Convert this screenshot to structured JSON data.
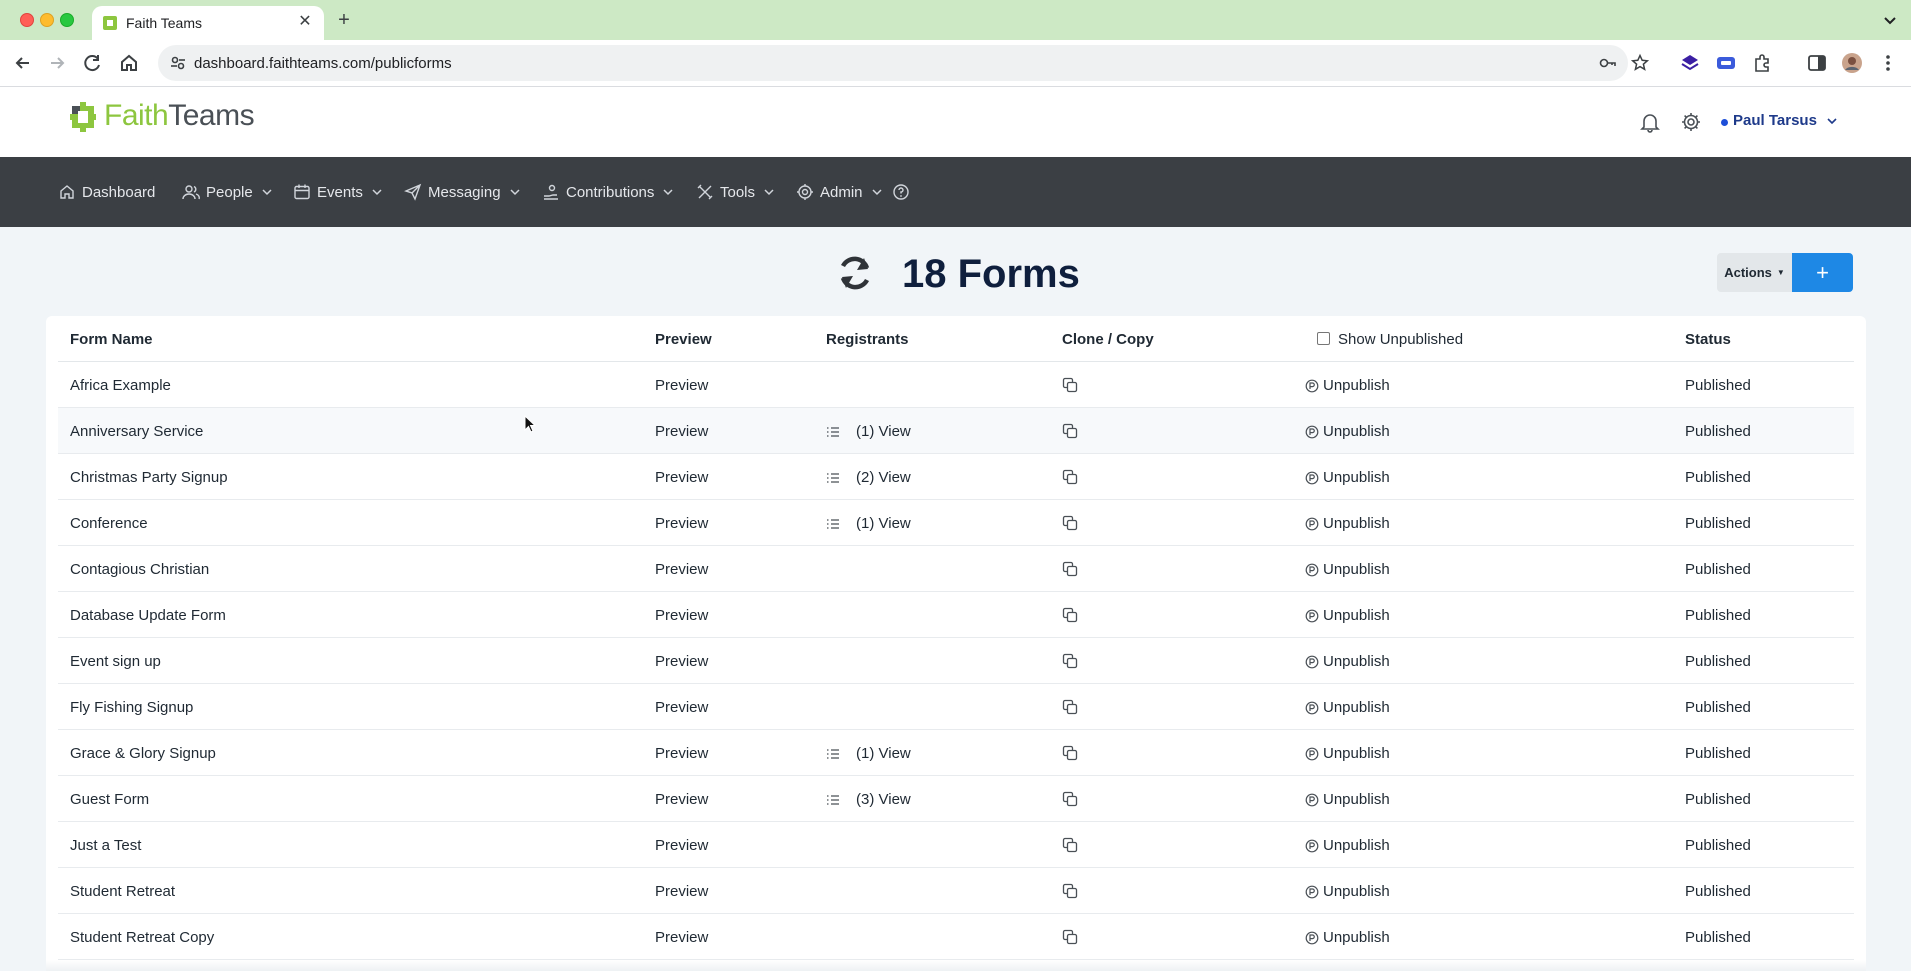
{
  "browser": {
    "tab_title": "Faith Teams",
    "url": "dashboard.faithteams.com/publicforms"
  },
  "brand": {
    "logo_part1": "Faith",
    "logo_part2": "Teams",
    "accent": "#8dc63f",
    "primary_button": "#1e88e5",
    "nav_bg": "#3b3f44"
  },
  "header": {
    "user_name": "Paul Tarsus"
  },
  "nav": {
    "items": [
      {
        "label": "Dashboard",
        "icon": "home-icon"
      },
      {
        "label": "People",
        "icon": "people-icon"
      },
      {
        "label": "Events",
        "icon": "calendar-icon"
      },
      {
        "label": "Messaging",
        "icon": "send-icon"
      },
      {
        "label": "Contributions",
        "icon": "hand-coin-icon"
      },
      {
        "label": "Tools",
        "icon": "tools-icon"
      },
      {
        "label": "Admin",
        "icon": "gear-icon"
      }
    ]
  },
  "page": {
    "title": "18 Forms",
    "actions_label": "Actions",
    "add_label": "+"
  },
  "table": {
    "headers": {
      "name": "Form Name",
      "preview": "Preview",
      "registrants": "Registrants",
      "clone": "Clone / Copy",
      "show_unpublished": "Show Unpublished",
      "status": "Status"
    },
    "rows": [
      {
        "name": "Africa Example",
        "preview": "Preview",
        "registrants": "",
        "unpublish": "Unpublish",
        "status": "Published"
      },
      {
        "name": "Anniversary Service",
        "preview": "Preview",
        "registrants": "(1) View",
        "unpublish": "Unpublish",
        "status": "Published"
      },
      {
        "name": "Christmas Party Signup",
        "preview": "Preview",
        "registrants": "(2) View",
        "unpublish": "Unpublish",
        "status": "Published"
      },
      {
        "name": "Conference",
        "preview": "Preview",
        "registrants": "(1) View",
        "unpublish": "Unpublish",
        "status": "Published"
      },
      {
        "name": "Contagious Christian",
        "preview": "Preview",
        "registrants": "",
        "unpublish": "Unpublish",
        "status": "Published"
      },
      {
        "name": "Database Update Form",
        "preview": "Preview",
        "registrants": "",
        "unpublish": "Unpublish",
        "status": "Published"
      },
      {
        "name": "Event sign up",
        "preview": "Preview",
        "registrants": "",
        "unpublish": "Unpublish",
        "status": "Published"
      },
      {
        "name": "Fly Fishing Signup",
        "preview": "Preview",
        "registrants": "",
        "unpublish": "Unpublish",
        "status": "Published"
      },
      {
        "name": "Grace & Glory Signup",
        "preview": "Preview",
        "registrants": "(1) View",
        "unpublish": "Unpublish",
        "status": "Published"
      },
      {
        "name": "Guest Form",
        "preview": "Preview",
        "registrants": "(3) View",
        "unpublish": "Unpublish",
        "status": "Published"
      },
      {
        "name": "Just a Test",
        "preview": "Preview",
        "registrants": "",
        "unpublish": "Unpublish",
        "status": "Published"
      },
      {
        "name": "Student Retreat",
        "preview": "Preview",
        "registrants": "",
        "unpublish": "Unpublish",
        "status": "Published"
      },
      {
        "name": "Student Retreat Copy",
        "preview": "Preview",
        "registrants": "",
        "unpublish": "Unpublish",
        "status": "Published"
      }
    ]
  }
}
